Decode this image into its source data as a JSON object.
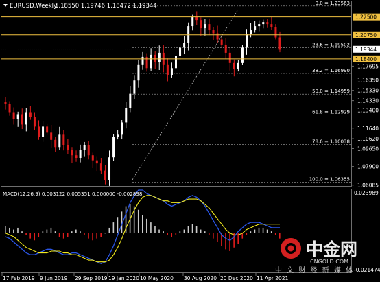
{
  "header": {
    "menu_icon": "triangle-down-icon",
    "symbol_title": "EURUSD,Weekly",
    "ohlc": "1.18550 1.19746 1.18472 1.19344"
  },
  "price_axis": {
    "ticks": [
      "1.22500",
      "1.20750",
      "1.19344",
      "1.18400",
      "1.17695",
      "1.16350",
      "1.15330",
      "1.14330",
      "1.13400",
      "1.11640",
      "1.10620",
      "1.09650",
      "1.07900",
      "1.06085"
    ],
    "ylim": [
      1.06,
      1.2395
    ]
  },
  "price_lines": [
    {
      "value": 1.225,
      "label": "1.22500",
      "color": "#f0c040"
    },
    {
      "value": 1.2075,
      "label": "1.20750",
      "color": "#f0c040"
    },
    {
      "value": 1.184,
      "label": "1.18400",
      "color": "#f0c040"
    },
    {
      "value": 1.19344,
      "label": "1.19344",
      "color": "#ffffff"
    }
  ],
  "fibonacci": {
    "levels": [
      {
        "label": "0.0 = 1.23563",
        "value": 1.23563
      },
      {
        "label": "23.6 = 1.19502",
        "value": 1.19502
      },
      {
        "label": "38.2 = 1.16990",
        "value": 1.1699
      },
      {
        "label": "50.0 = 1.14959",
        "value": 1.14959
      },
      {
        "label": "61.8 = 1.12929",
        "value": 1.12929
      },
      {
        "label": "78.6 = 1.10038",
        "value": 1.10038
      },
      {
        "label": "100.0 = 1.06355",
        "value": 1.06355
      }
    ]
  },
  "macd": {
    "title": "MACD(12,26,9) 0.003122 0.005351 0.000000 -0.002898",
    "axis_ticks": [
      "0.023989",
      "-0.021474"
    ]
  },
  "time_axis": {
    "labels": [
      "17 Feb 2019",
      "9 Jun 2019",
      "29 Sep 2019",
      "19 Jan 2020",
      "10 May 2020",
      "30 Aug 2020",
      "20 Dec 2020",
      "11 Apr 2021"
    ]
  },
  "watermark": {
    "logo_text": "中金网",
    "url": "CNGOLD.COM",
    "slogan": "中 文 财 经 新 媒 体"
  },
  "colors": {
    "background": "#000000",
    "bull": "#ffffff",
    "bear": "#e01c1c",
    "grid": "#6e6e6e",
    "horizontal_line": "#f0c040",
    "macd_line": "#2a56e8",
    "signal_line": "#f2ea1e",
    "logo_red": "#d42020"
  },
  "chart_data": {
    "type": "candlestick",
    "symbol": "EURUSD",
    "timeframe": "Weekly",
    "x": [
      "17 Feb 2019",
      "9 Jun 2019",
      "29 Sep 2019",
      "19 Jan 2020",
      "10 May 2020",
      "30 Aug 2020",
      "20 Dec 2020",
      "11 Apr 2021"
    ],
    "close_path": [
      1.14,
      1.132,
      1.125,
      1.13,
      1.12,
      1.132,
      1.127,
      1.118,
      1.108,
      1.118,
      1.112,
      1.105,
      1.098,
      1.11,
      1.1,
      1.095,
      1.09,
      1.087,
      1.095,
      1.1,
      1.09,
      1.085,
      1.082,
      1.075,
      1.066,
      1.088,
      1.108,
      1.11,
      1.122,
      1.136,
      1.15,
      1.163,
      1.178,
      1.186,
      1.175,
      1.188,
      1.181,
      1.19,
      1.178,
      1.168,
      1.175,
      1.187,
      1.195,
      1.2,
      1.216,
      1.225,
      1.222,
      1.214,
      1.218,
      1.212,
      1.209,
      1.203,
      1.198,
      1.19,
      1.18,
      1.174,
      1.18,
      1.195,
      1.208,
      1.212,
      1.216,
      1.218,
      1.22,
      1.218,
      1.215,
      1.205,
      1.193
    ],
    "macd_hist": [
      0.004,
      0.003,
      0.002,
      0.003,
      0.001,
      -0.001,
      -0.003,
      -0.004,
      -0.002,
      0.001,
      0.002,
      0.003,
      0.001,
      -0.002,
      -0.003,
      -0.002,
      0.001,
      0.002,
      0.001,
      -0.001,
      -0.003,
      -0.004,
      -0.003,
      -0.002,
      0.0,
      0.003,
      0.006,
      0.009,
      0.012,
      0.015,
      0.016,
      0.015,
      0.013,
      0.01,
      0.008,
      0.006,
      0.004,
      0.002,
      0.001,
      -0.001,
      -0.002,
      -0.001,
      0.001,
      0.002,
      0.004,
      0.005,
      0.004,
      0.002,
      0.001,
      -0.001,
      -0.003,
      -0.005,
      -0.007,
      -0.009,
      -0.01,
      -0.008,
      -0.006,
      -0.003,
      -0.001,
      0.001,
      0.002,
      0.003,
      0.003,
      0.002,
      0.001,
      -0.001,
      -0.003
    ],
    "macd_line": [
      -0.002,
      -0.003,
      -0.005,
      -0.007,
      -0.009,
      -0.011,
      -0.012,
      -0.012,
      -0.011,
      -0.01,
      -0.009,
      -0.009,
      -0.01,
      -0.011,
      -0.012,
      -0.012,
      -0.011,
      -0.011,
      -0.012,
      -0.013,
      -0.014,
      -0.015,
      -0.016,
      -0.017,
      -0.016,
      -0.012,
      -0.007,
      -0.001,
      0.005,
      0.011,
      0.017,
      0.021,
      0.024,
      0.024,
      0.022,
      0.021,
      0.02,
      0.019,
      0.018,
      0.016,
      0.015,
      0.016,
      0.017,
      0.018,
      0.02,
      0.021,
      0.02,
      0.018,
      0.015,
      0.011,
      0.007,
      0.003,
      -0.001,
      -0.003,
      -0.004,
      -0.002,
      0.001,
      0.003,
      0.005,
      0.006,
      0.006,
      0.006,
      0.005,
      0.004,
      0.003,
      0.003,
      0.003
    ],
    "signal_line": [
      0.0,
      -0.001,
      -0.002,
      -0.004,
      -0.006,
      -0.008,
      -0.009,
      -0.01,
      -0.011,
      -0.011,
      -0.011,
      -0.01,
      -0.01,
      -0.01,
      -0.011,
      -0.011,
      -0.012,
      -0.012,
      -0.013,
      -0.014,
      -0.015,
      -0.015,
      -0.016,
      -0.016,
      -0.016,
      -0.015,
      -0.012,
      -0.008,
      -0.003,
      0.003,
      0.008,
      0.013,
      0.017,
      0.02,
      0.021,
      0.021,
      0.02,
      0.019,
      0.018,
      0.018,
      0.017,
      0.017,
      0.017,
      0.018,
      0.019,
      0.019,
      0.019,
      0.018,
      0.016,
      0.014,
      0.011,
      0.008,
      0.005,
      0.002,
      0.0,
      -0.001,
      -0.001,
      0.0,
      0.002,
      0.003,
      0.004,
      0.005,
      0.005,
      0.005,
      0.005,
      0.005,
      0.005
    ],
    "macd_ylim": [
      -0.021474,
      0.023989
    ]
  }
}
